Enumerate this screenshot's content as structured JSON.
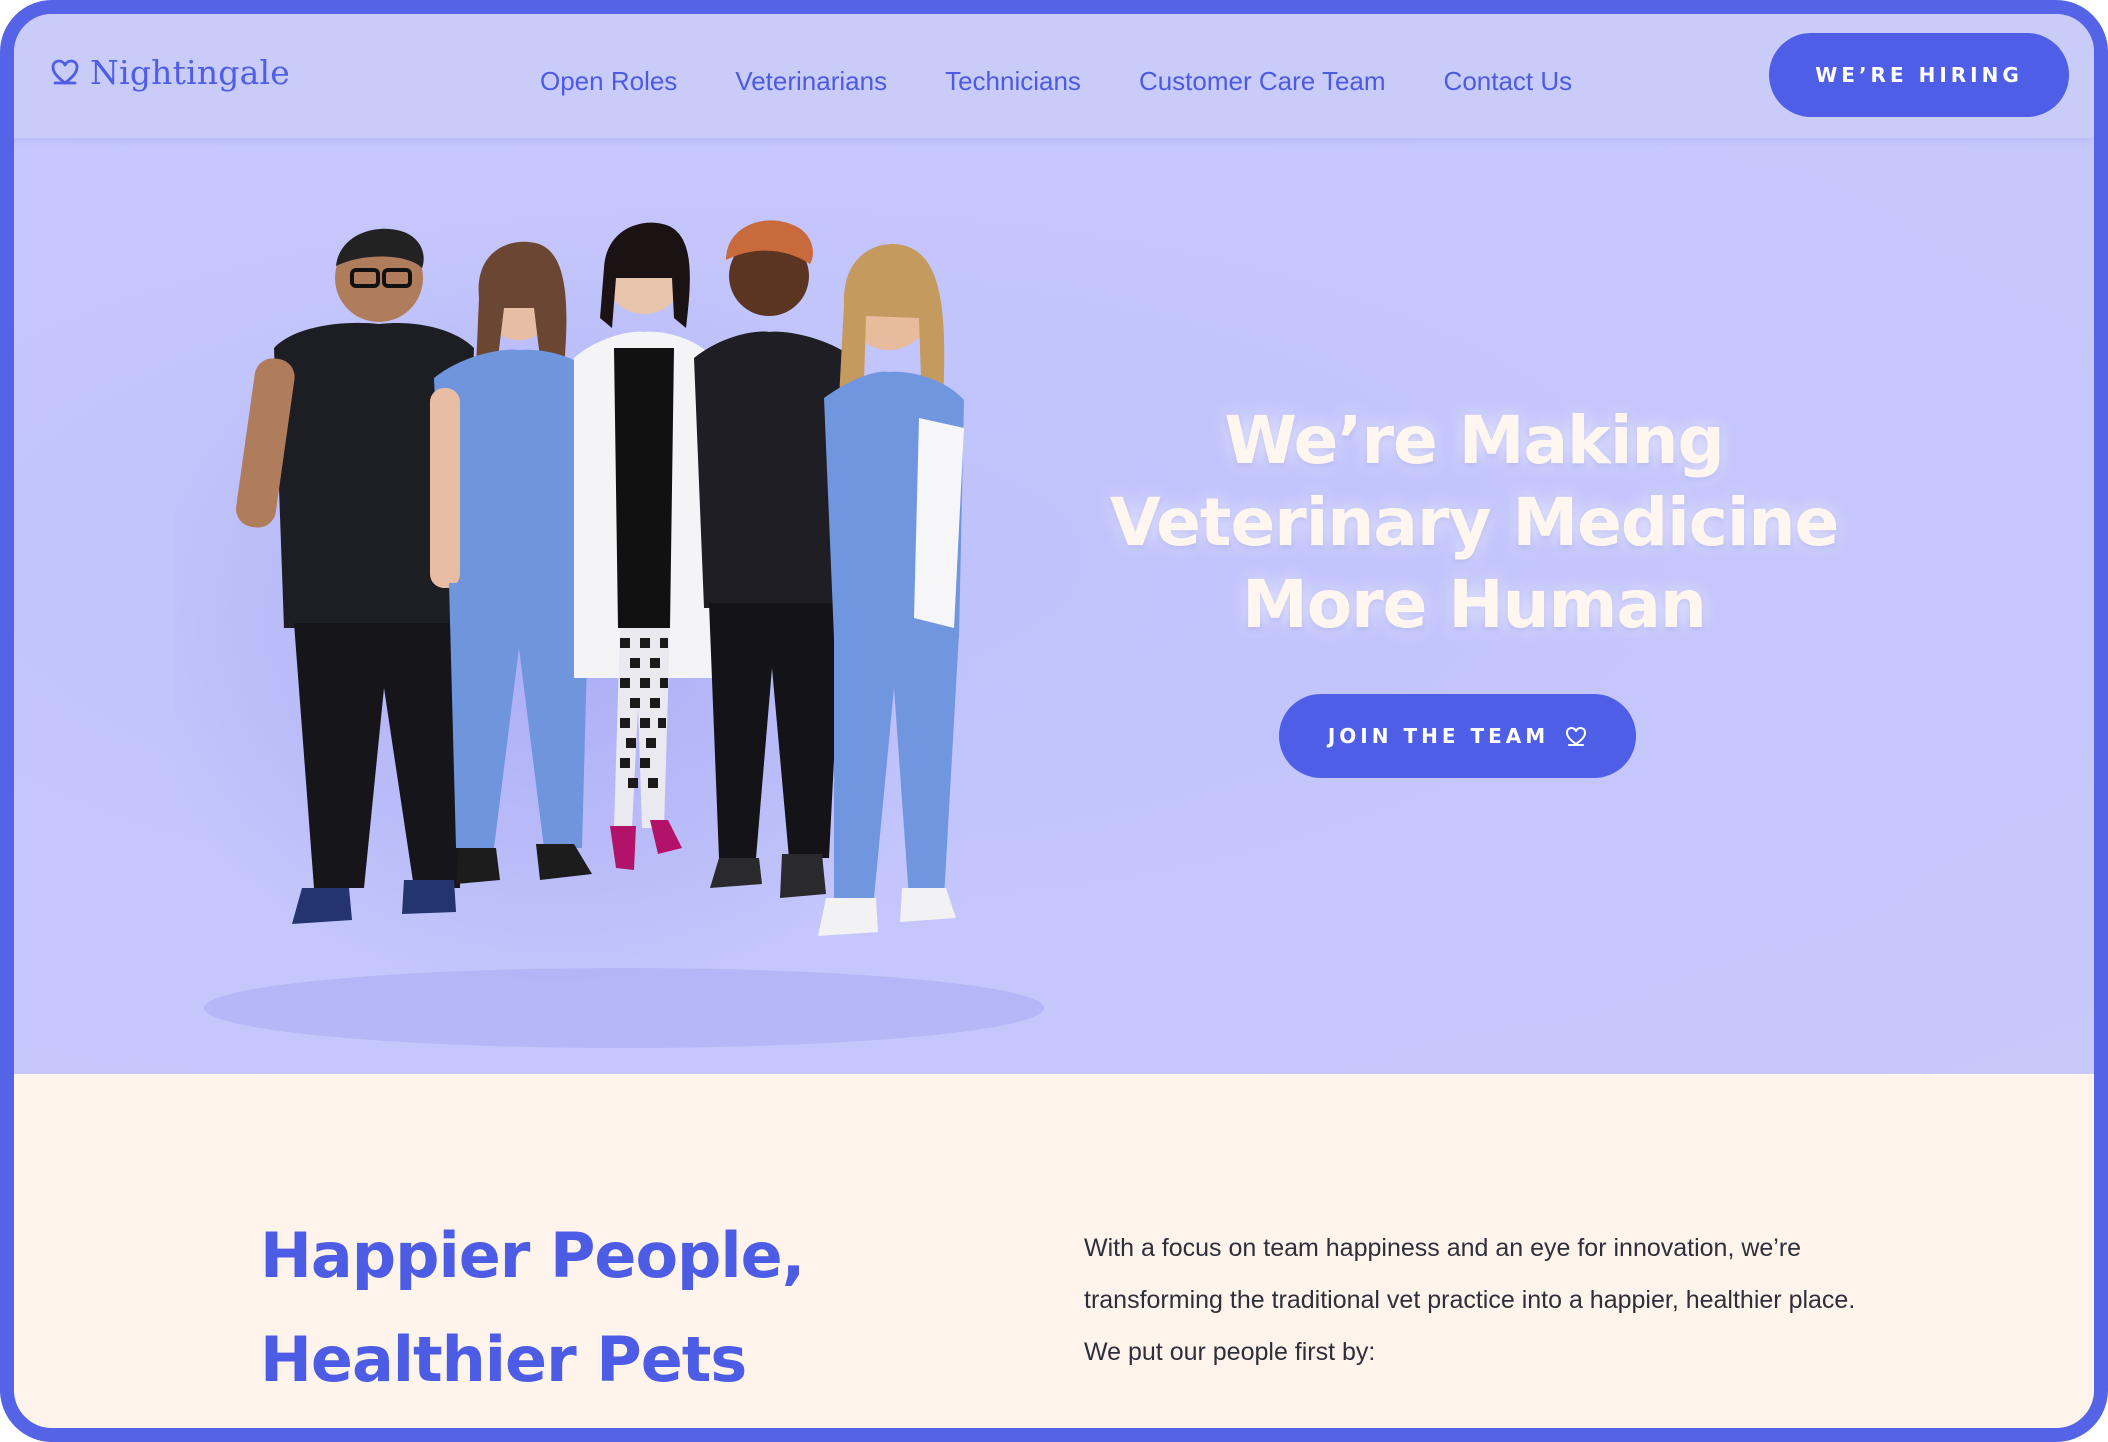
{
  "nav": {
    "logo_text": "Nightingale",
    "links": [
      "Open Roles",
      "Veterinarians",
      "Technicians",
      "Customer Care Team",
      "Contact Us"
    ],
    "cta_label": "WE’RE HIRING"
  },
  "hero": {
    "headline_lines": [
      "We’re Making",
      "Veterinary Medicine",
      "More Human"
    ],
    "cta_label": "JOIN THE TEAM",
    "photo_alt": "team-photo"
  },
  "intro": {
    "title_lines": [
      "Happier People,",
      "Healthier Pets"
    ],
    "body": "With a focus on team happiness and an eye for innovation, we’re transforming the traditional vet practice into a happier, healthier place.  We put our people first by:"
  },
  "colors": {
    "brand": "#4f5ee6",
    "hero_bg": "#c3c5fb",
    "cream": "#fef4ec",
    "frame": "#5563e6"
  },
  "icons": {
    "logo": "heart-outline-icon",
    "join": "heart-outline-icon"
  }
}
